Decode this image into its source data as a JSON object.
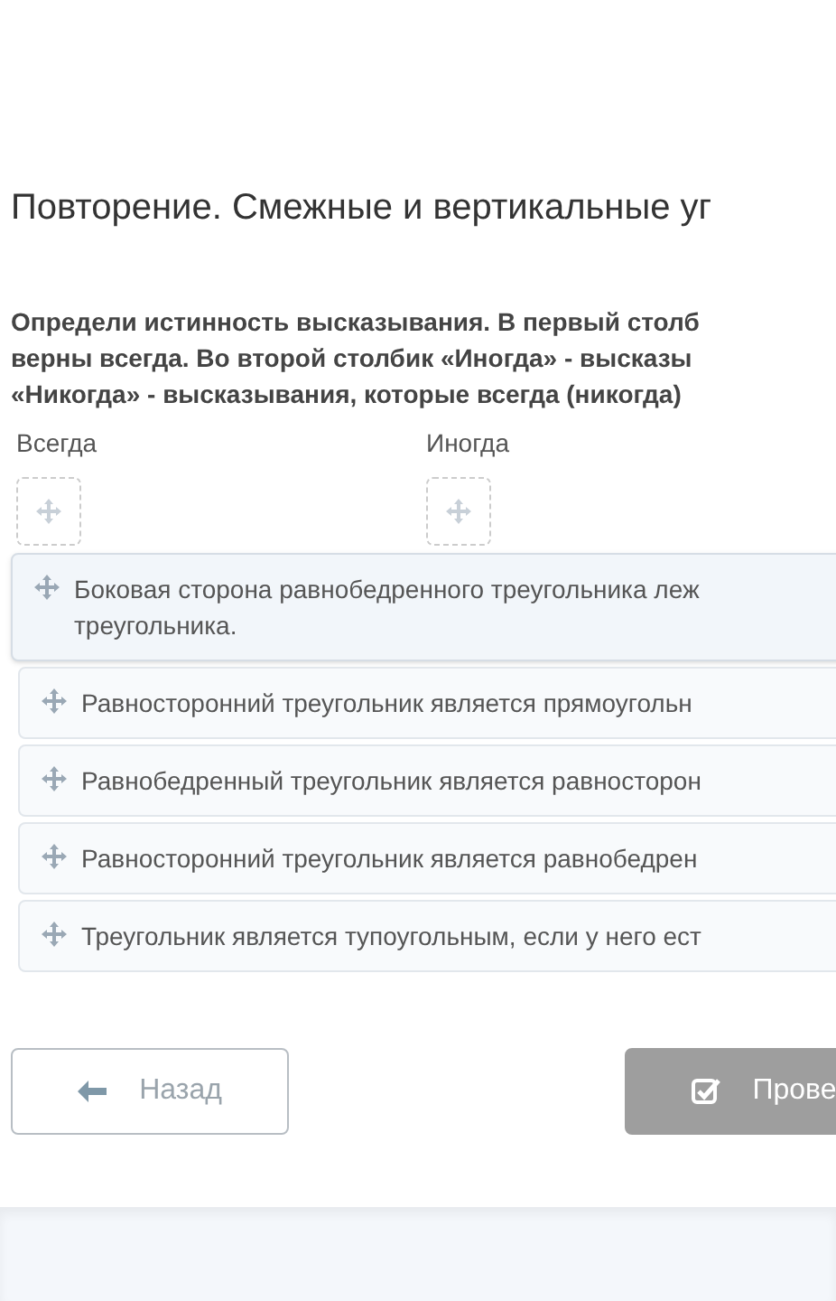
{
  "title": "Повторение. Смежные и вертикальные уг",
  "instruction_lines": [
    "Определи истинность высказывания. В первый столб",
    "верны всегда. Во второй столбик «Иногда» - высказы",
    "«Никогда» - высказывания, которые всегда (никогда)"
  ],
  "columns": [
    {
      "label": "Всегда"
    },
    {
      "label": "Иногда"
    }
  ],
  "items": [
    {
      "lines": [
        "Боковая сторона равнобедренного треугольника леж",
        "треугольника."
      ],
      "selected": true
    },
    {
      "lines": [
        "Равносторонний треугольник является прямоугольн"
      ],
      "selected": false
    },
    {
      "lines": [
        "Равнобедренный треугольник является равносторон"
      ],
      "selected": false
    },
    {
      "lines": [
        "Равносторонний треугольник является равнобедрен"
      ],
      "selected": false
    },
    {
      "lines": [
        "Треугольник является тупоугольным, если у него ест"
      ],
      "selected": false
    }
  ],
  "buttons": [
    {
      "kind": "back",
      "label": "Назад",
      "disabled": false
    },
    {
      "kind": "check",
      "label": "Прове",
      "disabled": true
    }
  ]
}
